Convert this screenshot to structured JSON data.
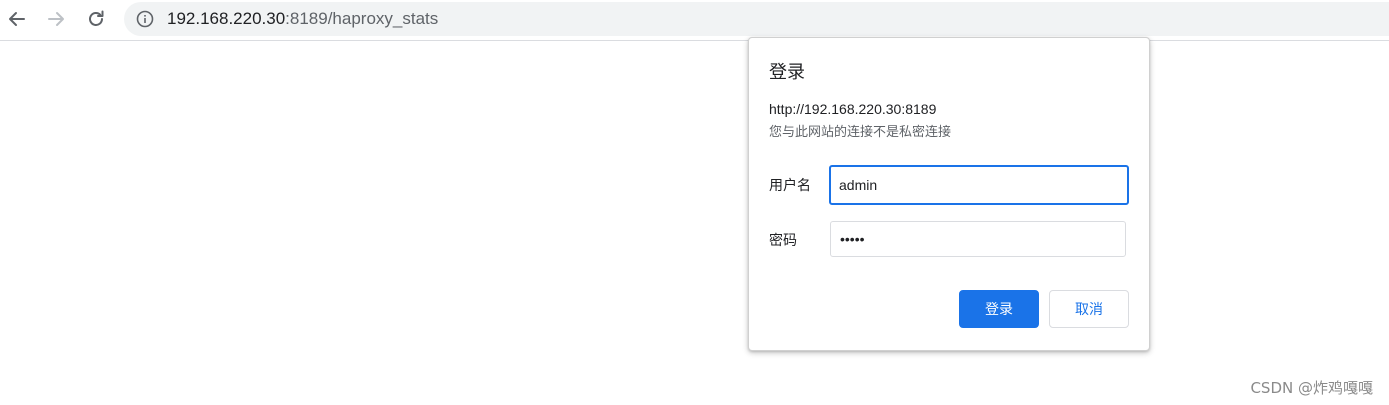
{
  "browser": {
    "url_host": "192.168.220.30",
    "url_rest": ":8189/haproxy_stats"
  },
  "dialog": {
    "title": "登录",
    "origin": "http://192.168.220.30:8189",
    "warning": "您与此网站的连接不是私密连接",
    "username_label": "用户名",
    "username_value": "admin",
    "password_label": "密码",
    "password_value": "*****",
    "submit_label": "登录",
    "cancel_label": "取消"
  },
  "watermark": "CSDN @炸鸡嘎嘎",
  "colors": {
    "accent": "#1a73e8",
    "omnibox": "#f1f3f4"
  },
  "icons": [
    "back-arrow-icon",
    "forward-arrow-icon",
    "reload-icon",
    "info-icon"
  ]
}
